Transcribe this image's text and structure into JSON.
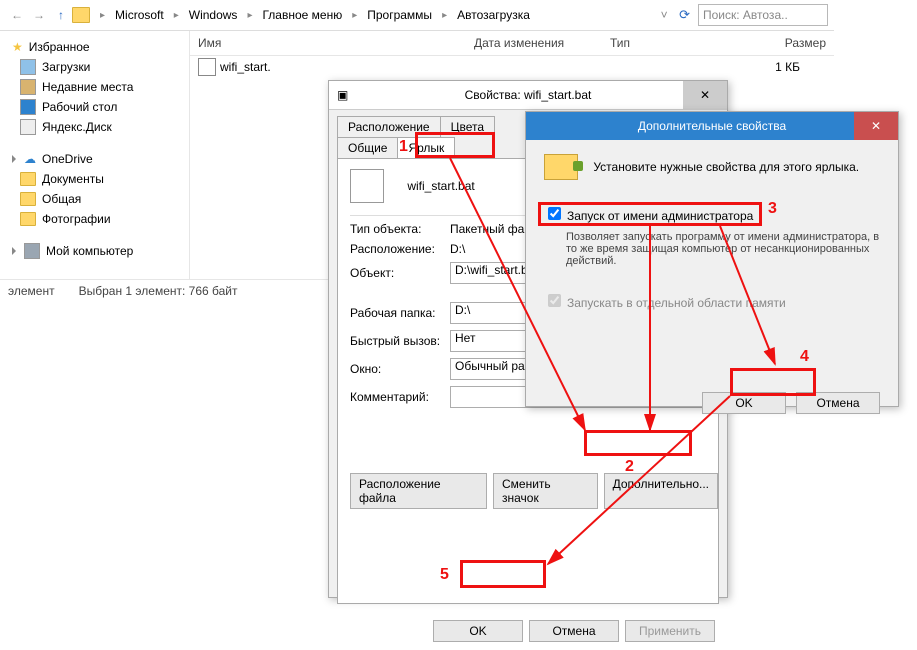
{
  "explorer": {
    "nav": {
      "back": "←",
      "fwd": "→",
      "up": "↑"
    },
    "breadcrumb": [
      "Microsoft",
      "Windows",
      "Главное меню",
      "Программы",
      "Автозагрузка"
    ],
    "search_placeholder": "Поиск: Автоза..",
    "sidebar": {
      "favorites": {
        "title": "Избранное",
        "items": [
          "Загрузки",
          "Недавние места",
          "Рабочий стол",
          "Яндекс.Диск"
        ]
      },
      "onedrive": {
        "title": "OneDrive",
        "items": [
          "Документы",
          "Общая",
          "Фотографии"
        ]
      },
      "computer": {
        "title": "Мой компьютер"
      }
    },
    "columns": {
      "name": "Имя",
      "date": "Дата изменения",
      "type": "Тип",
      "size": "Размер"
    },
    "row": {
      "name": "wifi_start.",
      "size": "1 КБ"
    },
    "status": {
      "left": "элемент",
      "right": "Выбран 1 элемент: 766 байт"
    }
  },
  "props": {
    "title": "Свойства: wifi_start.bat",
    "tabs_top": [
      "Расположение",
      "Цвета"
    ],
    "tabs_bottom": [
      "Общие",
      "Ярлык"
    ],
    "file_name": "wifi_start.bat",
    "rows": {
      "type_l": "Тип объекта:",
      "type_v": "Пакетный файл",
      "loc_l": "Расположение:",
      "loc_v": "D:\\",
      "obj_l": "Объект:",
      "obj_v": "D:\\wifi_start.bat",
      "wd_l": "Рабочая папка:",
      "wd_v": "D:\\",
      "hot_l": "Быстрый вызов:",
      "hot_v": "Нет",
      "win_l": "Окно:",
      "win_v": "Обычный разм",
      "com_l": "Комментарий:",
      "com_v": ""
    },
    "btns": {
      "loc": "Расположение файла",
      "icon": "Сменить значок",
      "adv": "Дополнительно..."
    },
    "footer": {
      "ok": "OK",
      "cancel": "Отмена",
      "apply": "Применить"
    }
  },
  "adv": {
    "title": "Дополнительные свойства",
    "intro": "Установите нужные свойства для этого ярлыка.",
    "run_admin": "Запуск от имени администратора",
    "run_admin_desc": "Позволяет запускать программу от имени администратора, в то же время защищая компьютер от несанкционированных действий.",
    "sep_mem": "Запускать в отдельной области памяти",
    "ok": "OK",
    "cancel": "Отмена"
  },
  "marks": {
    "m1": "1",
    "m2": "2",
    "m3": "3",
    "m4": "4",
    "m5": "5"
  }
}
